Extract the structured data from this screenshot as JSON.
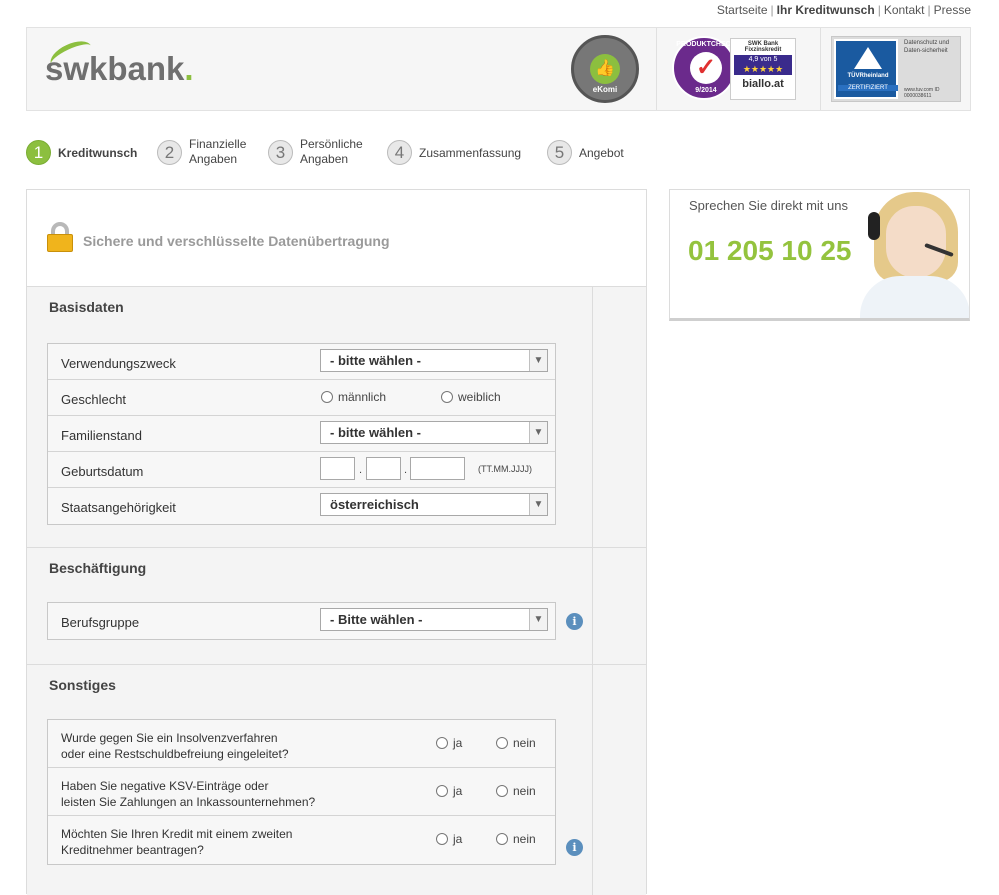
{
  "topnav": {
    "items": [
      "Startseite",
      "Ihr Kreditwunsch",
      "Kontakt",
      "Presse"
    ],
    "separator": "|"
  },
  "header": {
    "logo_text": "swkbank",
    "logo_dot": ".",
    "ekomi": {
      "arc_text": "KUNDENAUSZEICHNUNG",
      "brand": "eKomi",
      "icon": "thumbs-up-icon"
    },
    "produktcheck": {
      "circle_top": "PRODUKTCHECK",
      "circle_bottom": "9/2014",
      "card_title": "SWK Bank Fixzinskredit",
      "score": "4,9 von 5",
      "stars": "★★★★★",
      "brand": "biallo.at"
    },
    "tuv": {
      "name": "TÜVRheinland",
      "zert": "ZERTIFIZIERT",
      "right_text": "Datenschutz und Daten-sicherheit",
      "small_text": "www.tuv.com ID 0000038611"
    }
  },
  "steps": [
    {
      "num": "1",
      "label": "Kreditwunsch",
      "active": true
    },
    {
      "num": "2",
      "label_line1": "Finanzielle",
      "label_line2": "Angaben"
    },
    {
      "num": "3",
      "label_line1": "Persönliche",
      "label_line2": "Angaben"
    },
    {
      "num": "4",
      "label": "Zusammenfassung"
    },
    {
      "num": "5",
      "label": "Angebot"
    }
  ],
  "secure": {
    "text": "Sichere und verschlüsselte Datenübertragung"
  },
  "basisdaten": {
    "title": "Basisdaten",
    "verwendungszweck": {
      "label": "Verwendungszweck",
      "value": "- bitte wählen -"
    },
    "geschlecht": {
      "label": "Geschlecht",
      "opt1": "männlich",
      "opt2": "weiblich"
    },
    "familienstand": {
      "label": "Familienstand",
      "value": "- bitte wählen -"
    },
    "geburtsdatum": {
      "label": "Geburtsdatum",
      "sep": ".",
      "hint": "(TT.MM.JJJJ)"
    },
    "staatsangehoerigkeit": {
      "label": "Staatsangehörigkeit",
      "value": "österreichisch"
    }
  },
  "beschaeftigung": {
    "title": "Beschäftigung",
    "berufsgruppe": {
      "label": "Berufsgruppe",
      "value": "- Bitte wählen -"
    }
  },
  "sonstiges": {
    "title": "Sonstiges",
    "questions": [
      {
        "line1": "Wurde gegen Sie ein Insolvenzverfahren",
        "line2": "oder eine Restschuldbefreiung eingeleitet?",
        "yes": "ja",
        "no": "nein"
      },
      {
        "line1": "Haben Sie negative KSV-Einträge oder",
        "line2": "leisten Sie Zahlungen an Inkassounternehmen?",
        "yes": "ja",
        "no": "nein"
      },
      {
        "line1": "Möchten Sie Ihren Kredit mit einem zweiten",
        "line2": "Kreditnehmer beantragen?",
        "yes": "ja",
        "no": "nein"
      }
    ]
  },
  "contact": {
    "caption": "Sprechen Sie direkt mit uns",
    "phone": "01 205 10 25"
  },
  "icons": {
    "info": "i",
    "dropdown": "▼"
  },
  "colors": {
    "accent_green": "#8cbf3f",
    "phone_green": "#94c33e",
    "info_blue": "#5b8fbd"
  }
}
